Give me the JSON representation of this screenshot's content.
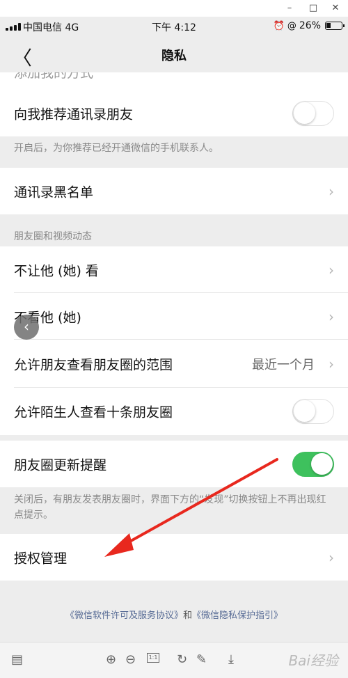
{
  "window": {
    "minimize": "–",
    "maximize": "□",
    "close": "✕"
  },
  "status": {
    "carrier": "中国电信 4G",
    "time": "下午 4:12",
    "battery": "26%"
  },
  "nav": {
    "title": "隐私",
    "back": "〈"
  },
  "truncated_row": "添加我的方式",
  "rows": {
    "recommend_contacts": "向我推荐通讯录朋友",
    "recommend_hint": "开启后，为你推荐已经开通微信的手机联系人。",
    "blacklist": "通讯录黑名单",
    "moments_section": "朋友圈和视频动态",
    "hide_from": "不让他 (她) 看",
    "not_see": "不看他 (她)",
    "moments_range": "允许朋友查看朋友圈的范围",
    "moments_range_value": "最近一个月",
    "stranger_ten": "允许陌生人查看十条朋友圈",
    "moments_update": "朋友圈更新提醒",
    "update_hint": "关闭后，有朋友发表朋友圈时，界面下方的“发现”切换按钮上不再出现红点提示。",
    "auth_manage": "授权管理"
  },
  "toggles": {
    "recommend_contacts": false,
    "stranger_ten": false,
    "moments_update": true
  },
  "footer": {
    "license": "《微信软件许可及服务协议》",
    "and": "和",
    "privacy": "《微信隐私保护指引》"
  },
  "toolbar": {
    "actual_size": "1:1",
    "watermark": "Bai经验"
  },
  "colors": {
    "toggle_on": "#3ec15d",
    "link": "#576b95",
    "arrow": "#e8281e"
  }
}
